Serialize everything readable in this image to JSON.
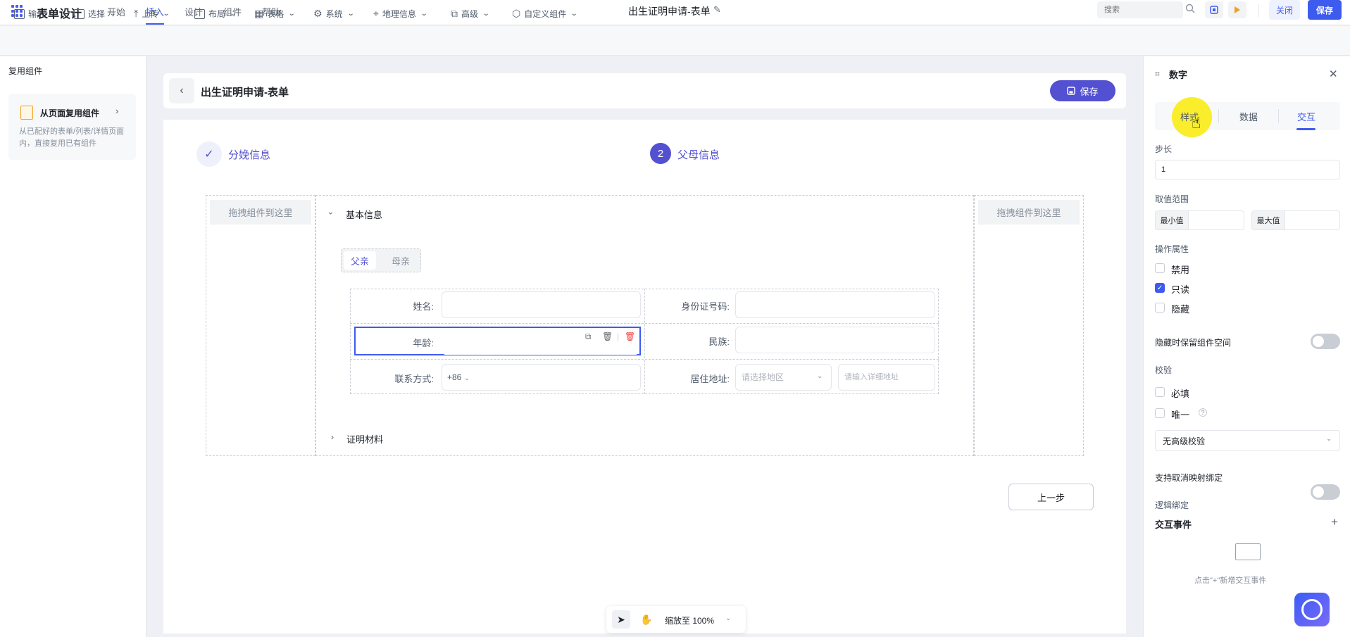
{
  "topbar": {
    "app_title": "表单设计",
    "menu": [
      "开始",
      "插入",
      "设计",
      "组件",
      "帮助"
    ],
    "active_menu": "插入",
    "doc_title": "出生证明申请-表单",
    "search_placeholder": "搜索",
    "close_label": "关闭",
    "save_label": "保存"
  },
  "toolbar": {
    "items": [
      "输入",
      "选择",
      "上传",
      "布局",
      "表格",
      "系统",
      "地理信息",
      "高级",
      "自定义组件"
    ]
  },
  "left_panel": {
    "title": "复用组件",
    "card_title": "从页面复用组件",
    "card_desc": "从已配好的表单/列表/详情页面内，直接复用已有组件"
  },
  "form": {
    "title": "出生证明申请-表单",
    "save_label": "保存",
    "steps": [
      {
        "label": "分娩信息",
        "status": "done"
      },
      {
        "number": "2",
        "label": "父母信息",
        "status": "current"
      }
    ],
    "drop_zone_text": "拖拽组件到这里",
    "section_basic": "基本信息",
    "tabs": [
      "父亲",
      "母亲"
    ],
    "active_tab": "父亲",
    "fields": {
      "name": "姓名:",
      "id_number": "身份证号码:",
      "age": "年龄:",
      "ethnicity": "民族:",
      "phone": "联系方式:",
      "phone_prefix": "+86",
      "address": "居住地址:",
      "region_placeholder": "请选择地区",
      "address_placeholder": "请输入详细地址"
    },
    "section_cert": "证明材料",
    "prev_label": "上一步"
  },
  "zoom": {
    "label": "缩放至 100%"
  },
  "right_panel": {
    "title": "数字",
    "tabs": [
      "样式",
      "数据",
      "交互"
    ],
    "active_tab": "交互",
    "step_label": "步长",
    "step_value": "1",
    "range_label": "取值范围",
    "min_label": "最小值",
    "max_label": "最大值",
    "op_label": "操作属性",
    "op_options": [
      {
        "label": "禁用",
        "checked": false
      },
      {
        "label": "只读",
        "checked": true
      },
      {
        "label": "隐藏",
        "checked": false
      }
    ],
    "keep_space_label": "隐藏时保留组件空间",
    "keep_space_on": false,
    "validation_label": "校验",
    "required_label": "必填",
    "unique_label": "唯一",
    "advanced_validation": "无高级校验",
    "unmap_label": "支持取消映射绑定",
    "unmap_on": false,
    "logic_label": "逻辑绑定",
    "events_title": "交互事件",
    "events_empty": "点击\"+\"新增交互事件"
  },
  "colors": {
    "primary": "#3e5bf0",
    "accent": "#5350d1",
    "highlight": "#f9ec1a"
  }
}
